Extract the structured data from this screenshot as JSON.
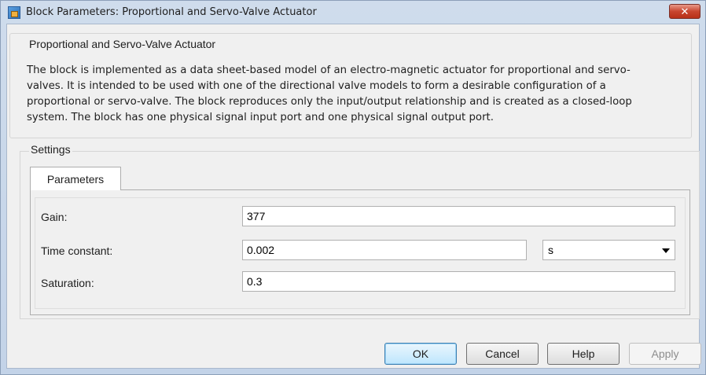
{
  "window": {
    "title": "Block Parameters: Proportional and Servo-Valve Actuator",
    "close_label": "✕"
  },
  "block": {
    "name": "Proportional and Servo-Valve Actuator",
    "description_lines": [
      "The block is implemented as a data sheet-based model of an electro-magnetic actuator for proportional and servo-",
      "valves. It is intended to be used with one of the directional valve models to form a desirable configuration of a",
      "proportional or servo-valve. The block reproduces only the input/output relationship and is created as a closed-loop",
      "system. The block has one physical signal input port and one physical signal output port."
    ]
  },
  "settings": {
    "title": "Settings",
    "tab_label": "Parameters",
    "params": [
      {
        "label": "Gain:",
        "value": "377"
      },
      {
        "label": "Time constant:",
        "value": "0.002",
        "unit": "s"
      },
      {
        "label": "Saturation:",
        "value": "0.3"
      }
    ]
  },
  "buttons": {
    "ok": "OK",
    "cancel": "Cancel",
    "help": "Help",
    "apply": "Apply"
  }
}
